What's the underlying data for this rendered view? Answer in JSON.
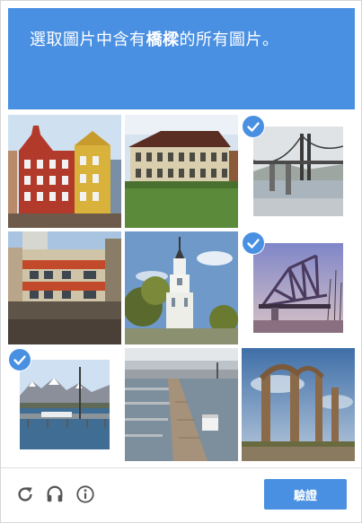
{
  "header": {
    "prompt_before": "選取圖片中含有",
    "prompt_emphasis": "橋樑",
    "prompt_after": "的所有圖片。",
    "background_color": "#4a90e2"
  },
  "tiles": [
    {
      "subject": "colorful-buildings",
      "selected": false
    },
    {
      "subject": "manor-house",
      "selected": false
    },
    {
      "subject": "suspension-bridge",
      "selected": true
    },
    {
      "subject": "brick-building",
      "selected": false
    },
    {
      "subject": "church-spire",
      "selected": false
    },
    {
      "subject": "truss-bridge",
      "selected": true
    },
    {
      "subject": "mountain-pier",
      "selected": true
    },
    {
      "subject": "harbor-dock",
      "selected": false
    },
    {
      "subject": "stone-arches",
      "selected": false
    }
  ],
  "footer": {
    "reload_icon": "reload-icon",
    "audio_icon": "headphones-icon",
    "info_icon": "info-icon",
    "verify_label": "驗證"
  },
  "colors": {
    "accent": "#4a90e2",
    "icon": "#555555"
  }
}
